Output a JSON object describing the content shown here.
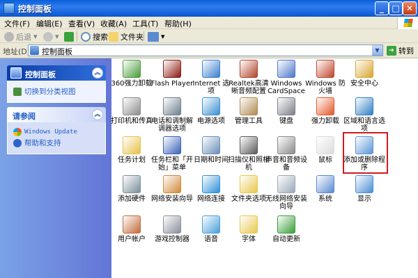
{
  "window": {
    "title": "控制面板",
    "buttons": {
      "minimize": "_",
      "maximize": "□",
      "close": "✕"
    }
  },
  "menu": [
    "文件(F)",
    "编辑(E)",
    "查看(V)",
    "收藏(A)",
    "工具(T)",
    "帮助(H)"
  ],
  "toolbar": {
    "back": "后退",
    "search": "搜索",
    "folders": "文件夹"
  },
  "address": {
    "label": "地址(D)",
    "value": "控制面板",
    "go": "转到"
  },
  "sidebar": {
    "panel1": {
      "title": "控制面板",
      "link": "切换到分类视图"
    },
    "panel2": {
      "title": "请参阅",
      "links": [
        "Windows Update",
        "帮助和支持"
      ]
    }
  },
  "items": [
    {
      "label": "360强力卸载",
      "color": "#4a9c3a"
    },
    {
      "label": "Flash Player",
      "color": "#8b1a10"
    },
    {
      "label": "Internet 选项",
      "color": "#3c7fcf"
    },
    {
      "label": "Realtek高清晰音频配置",
      "color": "#b0452c"
    },
    {
      "label": "Windows CardSpace",
      "color": "#4f77c8"
    },
    {
      "label": "Windows 防火墙",
      "color": "#c0462d"
    },
    {
      "label": "安全中心",
      "color": "#d9a531"
    },
    {
      "label": "打印机和传真",
      "color": "#8c8c8c"
    },
    {
      "label": "电话和调制解调器选项",
      "color": "#6e7e8e"
    },
    {
      "label": "电源选项",
      "color": "#3a8fd0"
    },
    {
      "label": "管理工具",
      "color": "#b08a50"
    },
    {
      "label": "键盘",
      "color": "#7a7f89"
    },
    {
      "label": "强力卸载",
      "color": "#e3582a"
    },
    {
      "label": "区域和语言选项",
      "color": "#2f7fc4"
    },
    {
      "label": "任务计划",
      "color": "#e6c248"
    },
    {
      "label": "任务栏和「开始」菜单",
      "color": "#3a62b8"
    },
    {
      "label": "日期和时间",
      "color": "#6a8fb8"
    },
    {
      "label": "扫描仪和照相机",
      "color": "#5a5a5a"
    },
    {
      "label": "声音和音频设备",
      "color": "#8a8a8a"
    },
    {
      "label": "鼠标",
      "color": "#dcdcdc"
    },
    {
      "label": "添加或删除程序",
      "color": "#5a96d4"
    },
    {
      "label": "添加硬件",
      "color": "#7a8f9a"
    },
    {
      "label": "网络安装向导",
      "color": "#d0893a"
    },
    {
      "label": "网络连接",
      "color": "#2f8fd8"
    },
    {
      "label": "文件夹选项",
      "color": "#e8c84c"
    },
    {
      "label": "无线网络安装向导",
      "color": "#9aa8b8"
    },
    {
      "label": "系统",
      "color": "#5b8ad0"
    },
    {
      "label": "显示",
      "color": "#4a8fd4"
    },
    {
      "label": "用户帐户",
      "color": "#c46a3a"
    },
    {
      "label": "游戏控制器",
      "color": "#8a8f9a"
    },
    {
      "label": "语音",
      "color": "#4aa0d8"
    },
    {
      "label": "字体",
      "color": "#e8c84c"
    },
    {
      "label": "自动更新",
      "color": "#3a9e3a"
    }
  ]
}
